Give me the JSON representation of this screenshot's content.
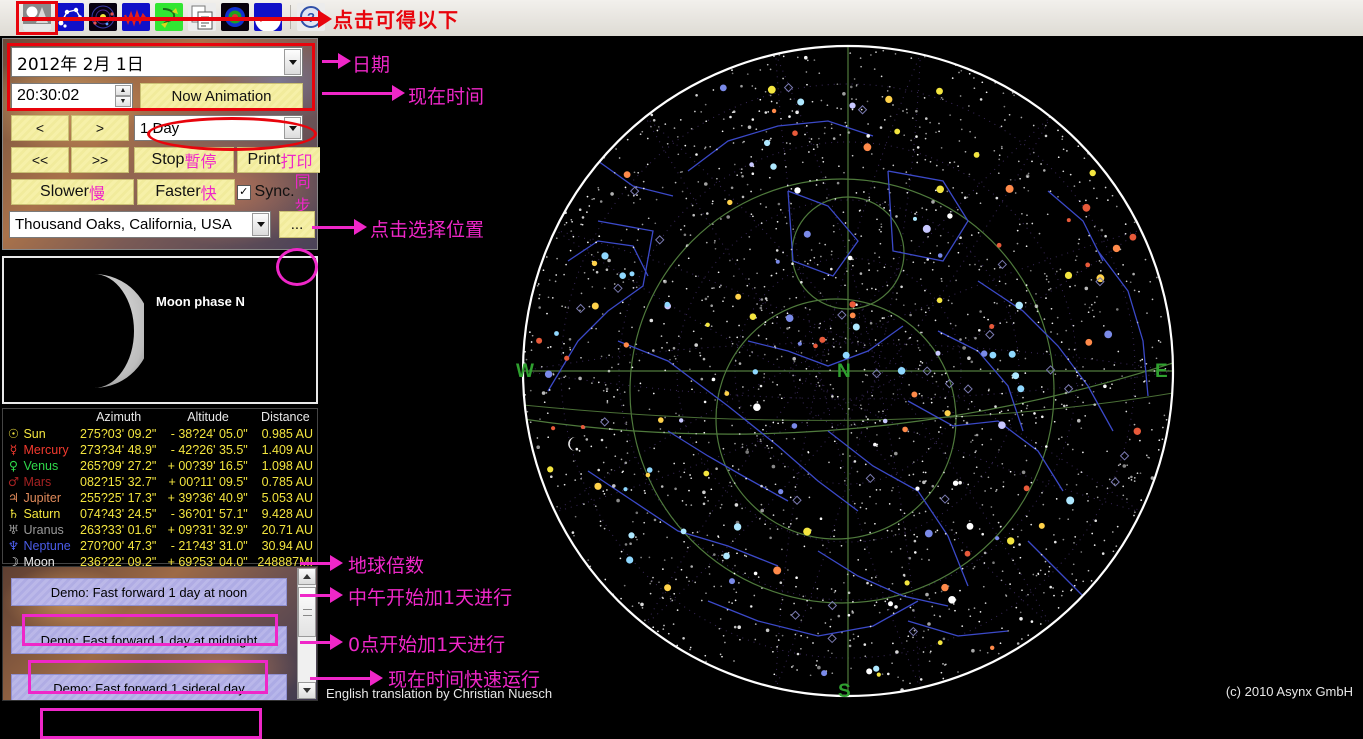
{
  "toolbar": {
    "buttons": [
      {
        "name": "sky-view-icon",
        "label": "Sky view"
      },
      {
        "name": "constellations-icon",
        "label": "Constellations"
      },
      {
        "name": "solar-system-icon",
        "label": "Solar system"
      },
      {
        "name": "graph-icon",
        "label": "Graph"
      },
      {
        "name": "earth-green-icon",
        "label": "Earth"
      },
      {
        "name": "copy-page-icon",
        "label": "Copy"
      },
      {
        "name": "globe-icon",
        "label": "Globe"
      },
      {
        "name": "moon-red-icon",
        "label": "Moon"
      },
      {
        "name": "help-icon",
        "label": "Help"
      }
    ],
    "annotation": "点击可得以下"
  },
  "controls": {
    "date_value": "2012年  2月  1日",
    "time_value": "20:30:02",
    "now_animation_label": "Now Animation",
    "step_back_label": "<",
    "step_fwd_label": ">",
    "step_back_fast_label": "<<",
    "step_fwd_fast_label": ">>",
    "interval_value": "1 Day",
    "stop_label_en": "Stop",
    "stop_label_cn": "暫停",
    "print_label_en": "Print",
    "print_label_cn": "打印",
    "slower_label_en": "Slower",
    "slower_label_cn": "慢",
    "faster_label_en": "Faster",
    "faster_label_cn": "快",
    "sync_label_en": "Sync.",
    "sync_label_cn": "同步",
    "sync_checked": true,
    "location_value": "Thousand Oaks, California, USA",
    "ellipsis_label": "..."
  },
  "moon": {
    "title": "Moon phase  N"
  },
  "planets": {
    "headers": [
      "",
      "Azimuth",
      "Altitude",
      "Distance"
    ],
    "rows": [
      {
        "symbol": "☉",
        "name": "Sun",
        "color": "#f3e53f",
        "azimuth": "275?03' 09.2\"",
        "altitude": "-  38?24' 05.0\"",
        "distance": "0.985 AU"
      },
      {
        "symbol": "☿",
        "name": "Mercury",
        "color": "#f23a2e",
        "azimuth": "273?34' 48.9\"",
        "altitude": "-  42?26' 35.5\"",
        "distance": "1.409 AU"
      },
      {
        "symbol": "♀",
        "name": "Venus",
        "color": "#2fd84a",
        "azimuth": "265?09' 27.2\"",
        "altitude": "+ 00?39' 16.5\"",
        "distance": "1.098 AU"
      },
      {
        "symbol": "♂",
        "name": "Mars",
        "color": "#a52222",
        "azimuth": "082?15' 32.7\"",
        "altitude": "+ 00?11' 09.5\"",
        "distance": "0.785 AU"
      },
      {
        "symbol": "♃",
        "name": "Jupiter",
        "color": "#e08a5a",
        "azimuth": "255?25' 17.3\"",
        "altitude": "+ 39?36' 40.9\"",
        "distance": "5.053 AU"
      },
      {
        "symbol": "♄",
        "name": "Saturn",
        "color": "#f3e53f",
        "azimuth": "074?43' 24.5\"",
        "altitude": "-  36?01' 57.1\"",
        "distance": "9.428 AU"
      },
      {
        "symbol": "♅",
        "name": "Uranus",
        "color": "#9a9a9a",
        "azimuth": "263?33' 01.6\"",
        "altitude": "+ 09?31' 32.9\"",
        "distance": "20.71 AU"
      },
      {
        "symbol": "♆",
        "name": "Neptune",
        "color": "#4a5ce8",
        "azimuth": "270?00' 47.3\"",
        "altitude": "-  21?43' 31.0\"",
        "distance": "30.94 AU"
      },
      {
        "symbol": "☽",
        "name": "Moon",
        "color": "#e9e9e9",
        "azimuth": "236?22' 09.2\"",
        "altitude": "+ 69?53' 04.0\"",
        "distance": "248887MI"
      }
    ]
  },
  "demos": {
    "buttons": [
      "Demo: Fast forward 1 day at noon",
      "Demo: Fast forward 1 day at midnight",
      "Demo: Fast forward 1 sideral day"
    ]
  },
  "annotations": [
    {
      "name": "annotation-date",
      "text": "日期"
    },
    {
      "name": "annotation-now-time",
      "text": "现在时间"
    },
    {
      "name": "annotation-choose-location",
      "text": "点击选择位置"
    },
    {
      "name": "annotation-earth-multiple",
      "text": "地球倍数"
    },
    {
      "name": "annotation-noon-plus-day",
      "text": "中午开始加1天进行"
    },
    {
      "name": "annotation-midnight-plus-day",
      "text": "0点开始加1天进行"
    },
    {
      "name": "annotation-fast-run",
      "text": "现在时间快速运行"
    }
  ],
  "sky": {
    "label_north": "N",
    "label_south": "S",
    "label_east": "E",
    "label_west": "W",
    "copyright": "(c) 2010 Asynx GmbH",
    "translation_credit": "English translation by Christian Nuesch",
    "accent_grid": "#4f7a3c",
    "accent_constellation": "#3b49c8",
    "horizon_color": "#ffffff"
  }
}
